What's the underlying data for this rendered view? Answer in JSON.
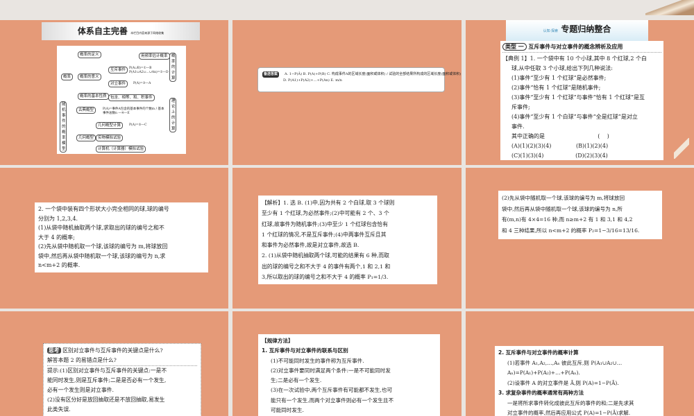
{
  "slide1": {
    "banner": "体系自主完善",
    "banner_sub": "本栏目内容来源于网络收集",
    "diagram": {
      "root": "概率",
      "items": [
        "概率的定义",
        "概率的意义",
        "概率的基本性质",
        "互斥事件",
        "对立事件",
        "包含、相等、和、积事件",
        "用频率估计概率",
        "概率的计算",
        "理论上的计算",
        "随机事件的概率模型",
        "古典概型",
        "几何概型",
        "几何概型计算",
        "实物模拟试验",
        "计算机（计算器）模拟试验"
      ],
      "formulas": [
        "P(A∪B)=①—B",
        "P(A1∪A2∪…∪An)=②—D",
        "P(A)=③—A",
        "P(A)=事件A包含的基本事件的个数m / 基本事件总数n —④—E",
        "P(A)=⑤—C"
      ]
    }
  },
  "slide2": {
    "label": "备选答案",
    "lines": [
      "A. 1−P(Ā)   B. P(A)+P(B)   C. 构成事件A的区域长度(面积或体积) / 试验的全部结果所构成的区域长度(面积或体积)",
      "D. P(A1)+P(A2)+…+P(An)   E. m/n"
    ]
  },
  "slide3": {
    "banner": "专题归纳整合",
    "banner_small": "认知·探索",
    "type_tag": "类型 一",
    "type_title": "互斥事件与对立事件的概念辨析及应用",
    "lines": [
      "【典例 1】1. 一个袋中有 10 个小球,其中 8 个红球,2 个白",
      "球,从中任取 3 个小球,给出下列几种说法:",
      "(1)事件“至少有 1 个红球”是必然事件;",
      "(2)事件“恰有 1 个红球”是随机事件;",
      "(3)事件“至少有 1 个红球”与事件“恰有 1 个红球”是互",
      "斥事件;",
      "(4)事件“至少有 1 个白球”与事件“全是红球”是对立",
      "事件.",
      "其中正确的是                              (    )",
      "(A)(1)(2)(3)(4)              (B)(1)(2)(4)",
      "(C)(1)(3)(4)                  (D)(2)(3)(4)"
    ]
  },
  "slide4": {
    "lines": [
      "2. 一个袋中装有四个形状大小完全相同的球,球的编号",
      "分别为 1,2,3,4.",
      "(1)从袋中随机抽取两个球,求取出的球的编号之和不",
      "大于 4 的概率;",
      "(2)先从袋中随机取一个球,该球的编号为 m,将球放回",
      "袋中,然后再从袋中随机取一个球,该球的编号为 n,求",
      "n<m+2 的概率."
    ]
  },
  "slide5": {
    "lines": [
      "【解析】1. 选 B. (1)中,因为共有 2 个白球,取 3 个球则",
      "至少有 1 个红球,为必然事件;(2)中可能有 2 个、3 个",
      "红球,故事件为随机事件;(3)中至少 1 个红球包含恰有",
      "1 个红球的情况,不是互斥事件;(4)中两事件互斥且其",
      "和事件为必然事件,故是对立事件,故选 B.",
      "2. (1)从袋中随机抽取两个球,可能的结果有 6 种,而取",
      "出的球的编号之和不大于 4 的事件有两个,1 和 2,1 和",
      "3,所以取出的球的编号之和不大于 4 的概率 P₁=1/3."
    ]
  },
  "slide6": {
    "lines": [
      "(2)先从袋中随机取一个球,该球的编号为 m,将球放回",
      "袋中,然后再从袋中随机取一个球,该球的编号为 n,所",
      "有(m,n)有 4×4=16 种,而 n≥m+2 有 1 和 3,1 和 4,2",
      "和 4 三种结果,所以 n<m+2 的概率 P₂=1−3/16=13/16."
    ]
  },
  "slide7": {
    "think": "思考",
    "q_lines": [
      "区别对立事件与互斥事件的关键点是什么?",
      "解答本题 2 的易错点是什么?"
    ],
    "a_lines": [
      "提示:(1)区别对立事件与互斥事件的关键点:一是不",
      "能同时发生,则是互斥事件;二是是否必有一个发生,",
      "必有一个发生则是对立事件.",
      "(2)没有区分好是放回抽取还是不放回抽取,易发生",
      "此类失误."
    ]
  },
  "slide8": {
    "lines": [
      "【规律方法】",
      "1. 互斥事件与对立事件的联系与区别",
      "(1)不可能同时发生的事件称为互斥事件.",
      "(2)对立事件要同时满足两个条件:一是不可能同时发",
      "生;二是必有一个发生.",
      "(3)在一次试验中,两个互斥事件有可能都不发生,也可",
      "能只有一个发生,而两个对立事件则必有一个发生且不",
      "可能同时发生."
    ]
  },
  "slide9": {
    "lines": [
      "2. 互斥事件与对立事件的概率计算",
      "(1)若事件 A₁,A₂,…,Aₙ 彼此互斥,则 P(A₁∪A₂∪…",
      "Aₙ)=P(A₁)+P(A₂)+…+P(Aₙ).",
      "(2)设事件 A 的对立事件是 Ā,则 P(A)=1−P(Ā).",
      "3. 求复杂事件的概率通常有两种方法",
      "一是将所求事件转化成彼此互斥的事件的和;二是先求其",
      "对立事件的概率,然后再应用公式 P(A)=1−P(Ā)求解."
    ]
  }
}
